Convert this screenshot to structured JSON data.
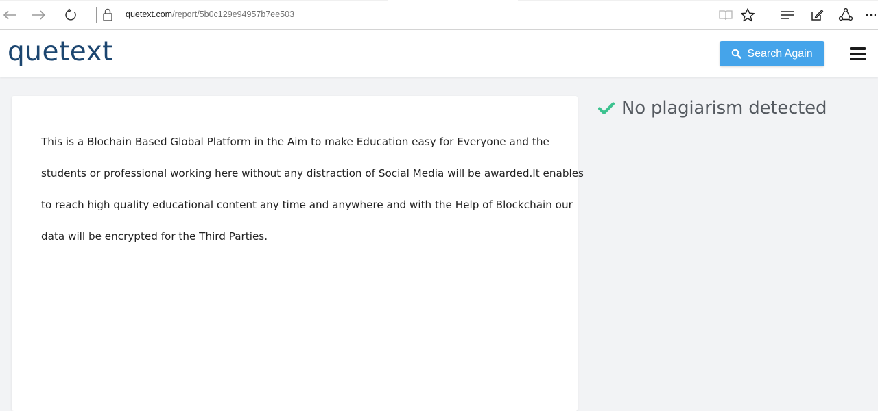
{
  "browser": {
    "url_domain": "quetext.com",
    "url_path": "/report/5b0c129e94957b7ee503",
    "icons": [
      "back-arrow-icon",
      "forward-arrow-icon",
      "refresh-icon",
      "lock-icon",
      "reading-view-icon",
      "favorite-star-icon",
      "hub-icon",
      "web-note-icon",
      "share-icon",
      "more-icon"
    ]
  },
  "header": {
    "logo": "quetext",
    "search_again_label": "Search Again",
    "accent_color": "#45a4ea",
    "logo_color": "#1c4670"
  },
  "report": {
    "lines": [
      "This is a Blochain Based Global Platform in the Aim to make Education easy for Everyone and the",
      "students or professional working here without any distraction of Social Media will be awarded.It enables",
      "to reach high quality educational content any time and anywhere and with the Help of Blockchain our",
      "data will be encrypted for the Third Parties."
    ]
  },
  "result": {
    "status_text": "No plagiarism detected",
    "status_color": "#3cc28f"
  }
}
